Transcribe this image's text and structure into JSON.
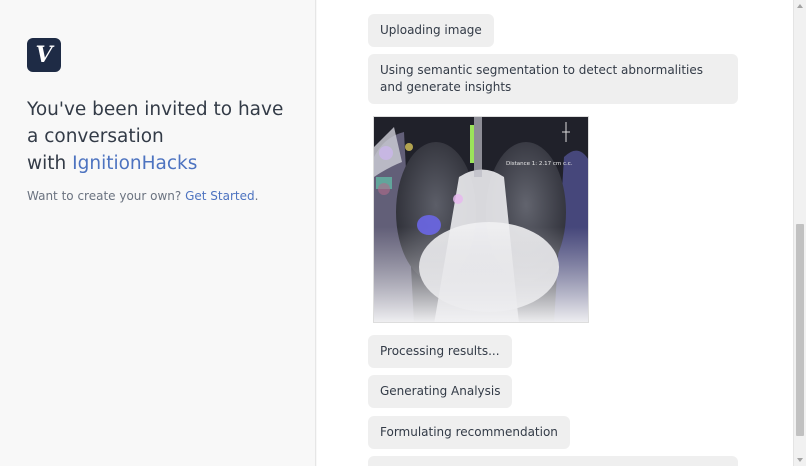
{
  "sidebar": {
    "logo_letter": "V",
    "heading_line1": "You've been invited to have a conversation",
    "heading_with": "with",
    "brand_name": "IgnitionHacks",
    "sub_text": "Want to create your own?",
    "get_started": "Get Started",
    "get_started_suffix": "."
  },
  "chat": {
    "messages": [
      "Uploading image",
      "Using semantic segmentation to detect abnormalities and generate insights",
      "Processing results...",
      "Generating Analysis",
      "Formulating recommendation"
    ],
    "image_overlay_text": "Distance 1: 2.17 cm c.c."
  },
  "colors": {
    "brand": "#4d73c0",
    "logo_bg": "#1e2b45",
    "bubble_bg": "#efefef"
  }
}
